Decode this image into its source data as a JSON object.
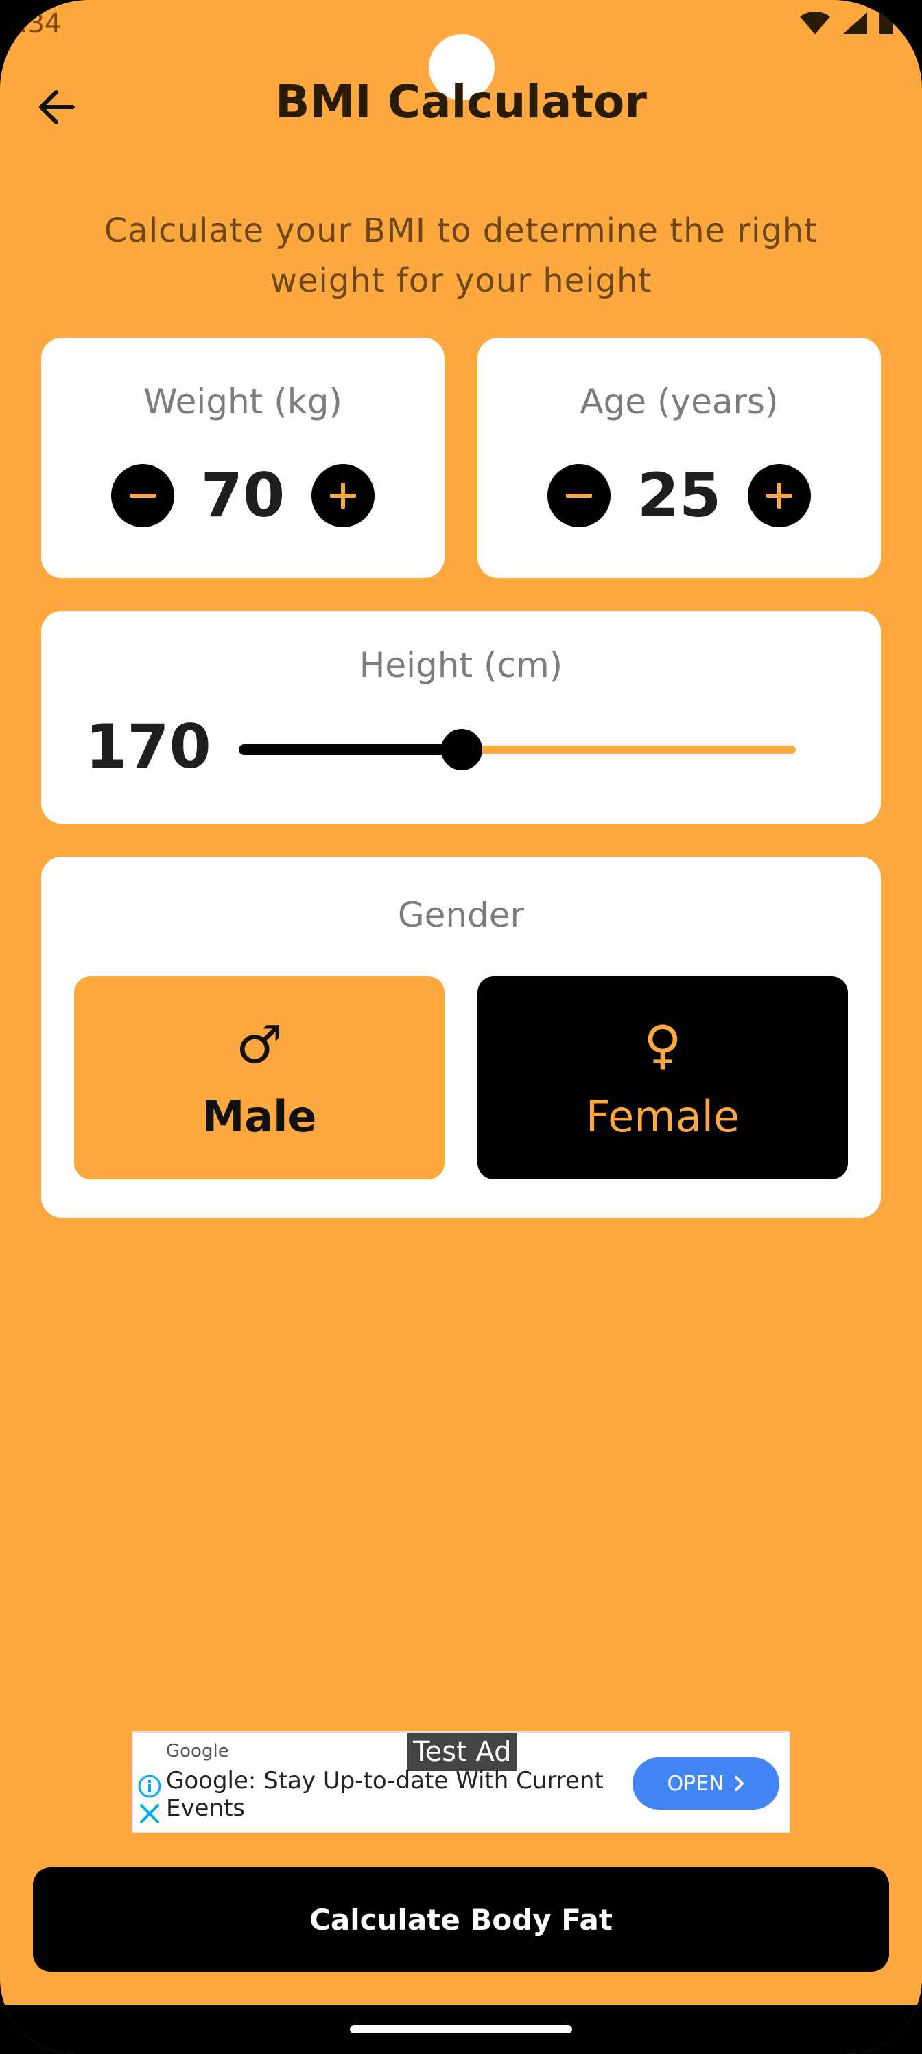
{
  "status_bar": {
    "time": ":34"
  },
  "app_bar": {
    "title": "BMI Calculator",
    "back_icon": "arrow-left-icon"
  },
  "subtitle": "Calculate your BMI to determine the right weight for your height",
  "weight": {
    "label": "Weight (kg)",
    "value": "70"
  },
  "age": {
    "label": "Age (years)",
    "value": "25"
  },
  "height": {
    "label": "Height (cm)",
    "value": "170",
    "slider_fraction": 0.4
  },
  "gender": {
    "label": "Gender",
    "male": {
      "label": "Male",
      "symbol": "♂"
    },
    "female": {
      "label": "Female",
      "symbol": "♀"
    },
    "selected": "female"
  },
  "ad": {
    "tag": "Test Ad",
    "source": "Google",
    "text": "Google: Stay Up-to-date With Current Events",
    "button": "OPEN"
  },
  "cta": {
    "label": "Calculate Body Fat"
  },
  "colors": {
    "accent": "#FDA93F",
    "dark": "#000000",
    "card": "#FFFFFF",
    "ad_button": "#4285F4"
  }
}
